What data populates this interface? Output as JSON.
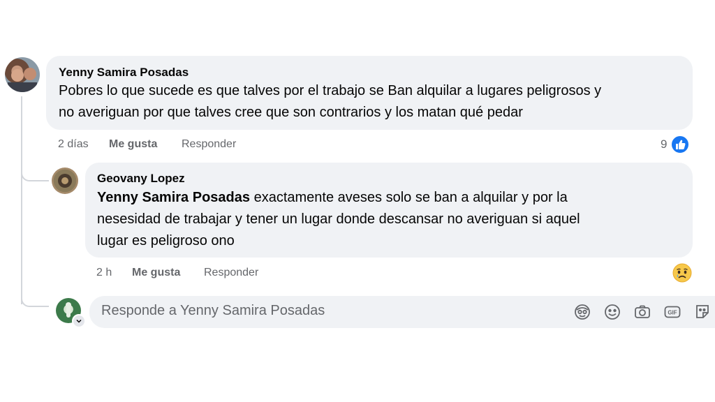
{
  "comment": {
    "author": "Yenny Samira Posadas",
    "text_line1": "Pobres lo que sucede es que talves por el trabajo se Ban alquilar a lugares peligrosos y",
    "text_line2": "no averiguan por que talves cree que son contrarios y los matan qué pedar",
    "time": "2 días",
    "like_label": "Me gusta",
    "reply_label": "Responder",
    "reaction_count": "9",
    "reaction_icon": "like-icon",
    "accent": "#1877f2"
  },
  "reply": {
    "author": "Geovany Lopez",
    "mention": "Yenny Samira Posadas",
    "text_line1_rest": " exactamente aveses solo se ban a alquilar y por la",
    "text_line2": "nesesidad de trabajar y tener un lugar donde descansar no averiguan si aquel",
    "text_line3": "lugar es peligroso ono",
    "time": "2 h",
    "like_label": "Me gusta",
    "reply_label": "Responder",
    "reaction_icon": "sad-reaction-icon"
  },
  "composer": {
    "placeholder": "Responde a Yenny Samira Posadas",
    "icons": [
      "avatar-sticker-icon",
      "emoji-icon",
      "camera-icon",
      "gif-icon",
      "sticker-icon"
    ]
  }
}
